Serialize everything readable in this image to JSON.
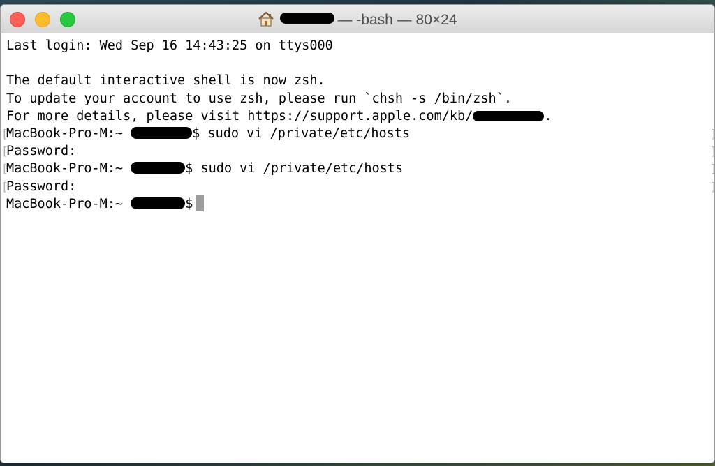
{
  "window": {
    "title": "— -bash — 80×24",
    "controls": {
      "close": "#fe5f57",
      "minimize": "#febc2e",
      "zoom": "#28c840"
    }
  },
  "terminal": {
    "last_login": "Last login: Wed Sep 16 14:43:25 on ttys000",
    "zsh_notice": "The default interactive shell is now zsh.",
    "zsh_update": "To update your account to use zsh, please run `chsh -s /bin/zsh`.",
    "details_prefix": "For more details, please visit https://support.apple.com/kb/",
    "details_suffix": ".",
    "prompt_host": "MacBook-Pro-M:~ ",
    "prompt_symbol": "$",
    "command": " sudo vi /private/etc/hosts",
    "password_prompt": "Password:"
  }
}
